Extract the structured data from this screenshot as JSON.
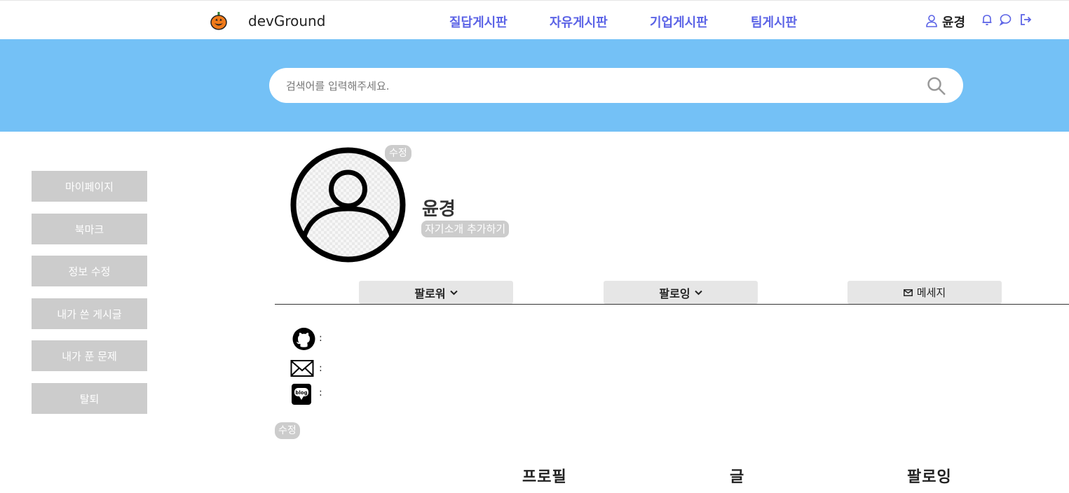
{
  "header": {
    "brand": "devGround",
    "nav": [
      "질답게시판",
      "자유게시판",
      "기업게시판",
      "팀게시판"
    ],
    "username": "윤경",
    "icons": [
      "user-icon",
      "bell-icon",
      "chat-icon",
      "logout-icon"
    ],
    "accent": "#5b63e6"
  },
  "search": {
    "placeholder": "검색어를 입력해주세요.",
    "band_color": "#74c1f6"
  },
  "sidebar": {
    "items": [
      "마이페이지",
      "북마크",
      "정보 수정",
      "내가 쓴 게시글",
      "내가 푼 문제",
      "탈퇴"
    ]
  },
  "profile": {
    "edit_photo_label": "수정",
    "name": "윤경",
    "bio_button": "자기소개 추가하기",
    "followers_label": "팔로워",
    "following_label": "팔로잉",
    "message_label": "메세지",
    "links": [
      {
        "icon": "github-icon",
        "separator": ":"
      },
      {
        "icon": "mail-icon",
        "separator": ":"
      },
      {
        "icon": "blog-icon",
        "separator": ":"
      }
    ],
    "edit_links_label": "수정"
  },
  "bottom_tabs": [
    "프로필",
    "글",
    "팔로잉"
  ]
}
